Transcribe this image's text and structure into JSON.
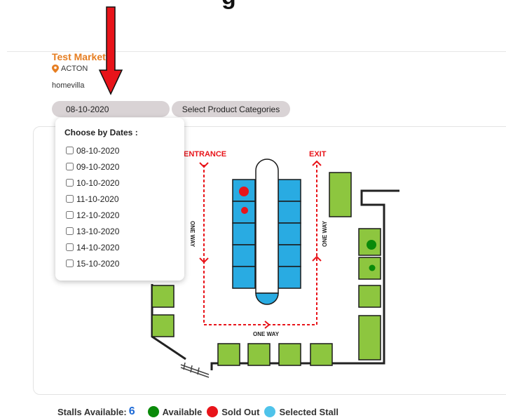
{
  "header": {
    "title_fragment": "g"
  },
  "market": {
    "name": "Test Market",
    "location": "ACTON",
    "owner": "homevilla"
  },
  "filters": {
    "selected_date": "08-10-2020",
    "categories_label": "Select Product Categories"
  },
  "dates_dropdown": {
    "heading": "Choose by Dates :",
    "options": [
      "08-10-2020",
      "09-10-2020",
      "10-10-2020",
      "11-10-2020",
      "12-10-2020",
      "13-10-2020",
      "14-10-2020",
      "15-10-2020"
    ]
  },
  "map": {
    "entrance_label": "ENTRANCE",
    "exit_label": "EXIT",
    "one_way_label": "ONE WAY"
  },
  "legend": {
    "stalls_available_label": "Stalls Available:",
    "stalls_available_count": "6",
    "available_label": "Available",
    "sold_out_label": "Sold Out",
    "selected_label": "Selected Stall"
  },
  "colors": {
    "accent": "#e67e22",
    "available": "#0a8a0a",
    "sold_out": "#e8141a",
    "selected": "#4fc3ea",
    "stall_green": "#8dc63f",
    "stall_blue": "#29abe2",
    "route_red": "#e8141a"
  }
}
